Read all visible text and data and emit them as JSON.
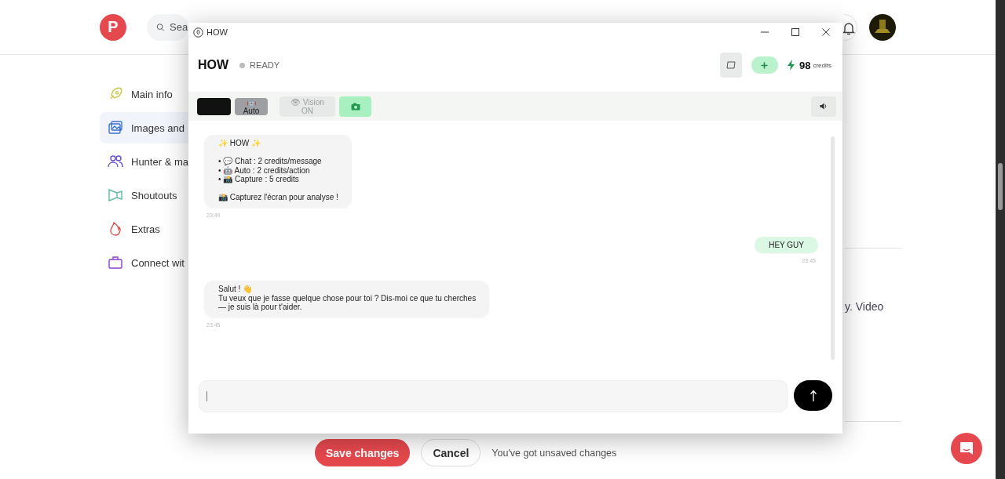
{
  "app": {
    "logo": "P",
    "search": {
      "placeholder": "Sea"
    },
    "sidebar": [
      {
        "label": "Main info",
        "selected": false
      },
      {
        "label": "Images and",
        "selected": true
      },
      {
        "label": "Hunter & ma",
        "selected": false
      },
      {
        "label": "Shoutouts",
        "selected": false
      },
      {
        "label": "Extras",
        "selected": false
      },
      {
        "label": "Connect wit",
        "selected": false
      }
    ],
    "fragment": "y. Video",
    "footer": {
      "save": "Save changes",
      "cancel": "Cancel",
      "status": "You've got unsaved changes"
    }
  },
  "chat_window": {
    "title": "HOW",
    "heading": "HOW",
    "status": "READY",
    "credits": {
      "amount": "98",
      "unit": "credits"
    },
    "toolbar": [
      {
        "kind": "swatch"
      },
      {
        "kind": "mode",
        "label": "🤖 Auto"
      },
      {
        "kind": "toggle",
        "label": "👁 Vision ON",
        "disabled": true
      },
      {
        "kind": "capture"
      }
    ],
    "messages": [
      {
        "kind": "bot",
        "text": "✨ HOW ✨\n\n• 💬 Chat : 2 credits/message\n• 🤖 Auto : 2 credits/action\n• 📸 Capture : 5 credits\n\n📸 Capturez l'écran pour analyse !",
        "time": "23:44"
      },
      {
        "kind": "user",
        "text": "HEY GUY",
        "time": "23:45"
      },
      {
        "kind": "bot",
        "text": "Salut ! 👋\nTu veux que je fasse quelque chose pour toi ? Dis-moi ce que tu cherches\n— je suis là pour t'aider.",
        "time": "23:45"
      }
    ]
  }
}
